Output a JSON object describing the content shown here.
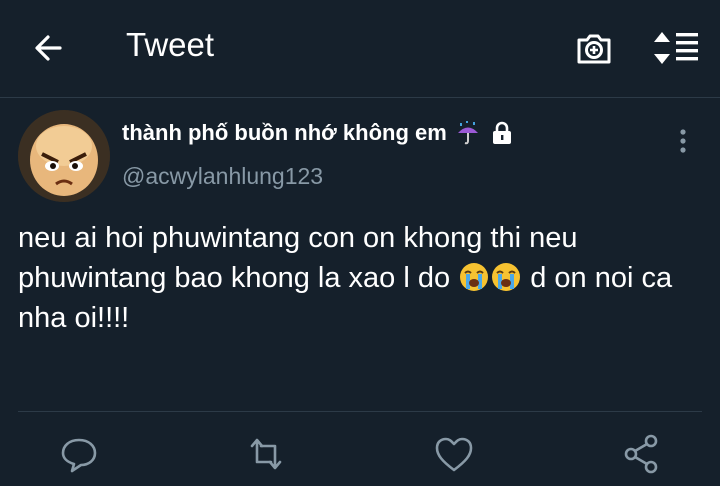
{
  "header": {
    "title": "Tweet",
    "back_icon": "arrow-left-icon",
    "camera_icon": "camera-icon",
    "sort_icon": "sort-list-icon"
  },
  "tweet": {
    "display_name": "thành phố buồn nhớ không em",
    "handle": "@acwylanhlung123",
    "name_icons": [
      "umbrella-rain-icon",
      "lock-icon"
    ],
    "text_part1": "neu ai hoi phuwintang con on khong thi neu phuwintang bao khong la xao l do ",
    "emoji": "loudly-crying-face",
    "text_part2": " d on noi ca nha oi!!!!"
  },
  "actions": [
    "reply-icon",
    "retweet-icon",
    "like-icon",
    "share-icon"
  ],
  "colors": {
    "background": "#15202b",
    "secondary_text": "#8899a6",
    "divider": "#2c3a47"
  }
}
